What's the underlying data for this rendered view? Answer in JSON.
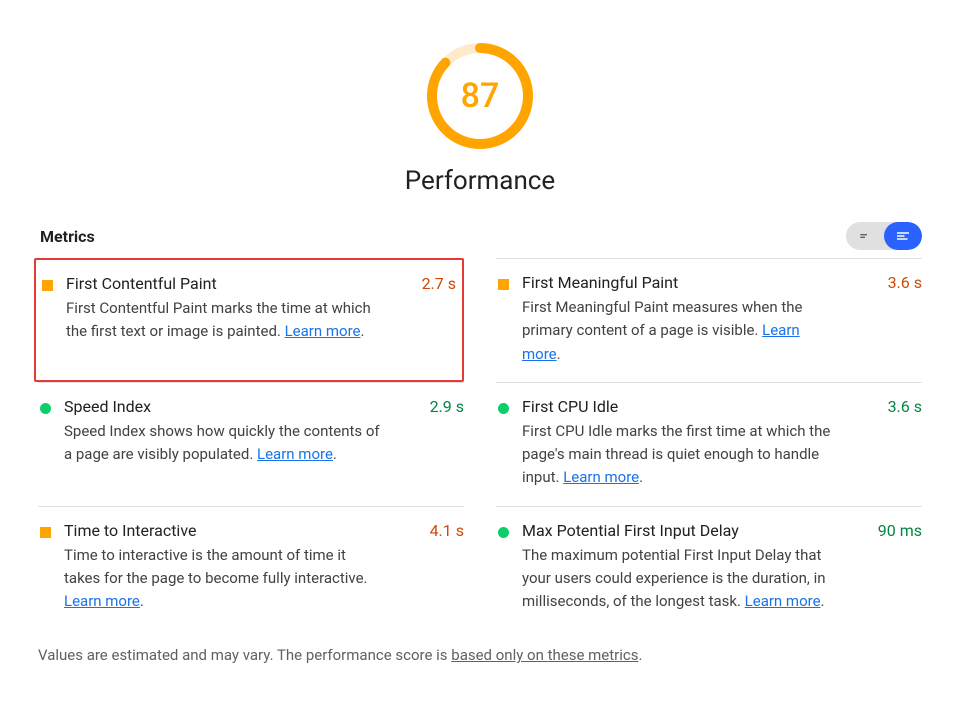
{
  "gauge": {
    "score": "87",
    "label": "Performance"
  },
  "section_title": "Metrics",
  "learn_more_text": "Learn more",
  "metrics": [
    {
      "title": "First Contentful Paint",
      "value": "2.7 s",
      "status": "avg",
      "highlight": true,
      "desc": "First Contentful Paint marks the time at which the first text or image is painted. "
    },
    {
      "title": "First Meaningful Paint",
      "value": "3.6 s",
      "status": "avg",
      "highlight": false,
      "desc": "First Meaningful Paint measures when the primary content of a page is visible. "
    },
    {
      "title": "Speed Index",
      "value": "2.9 s",
      "status": "good",
      "highlight": false,
      "desc": "Speed Index shows how quickly the contents of a page are visibly populated. "
    },
    {
      "title": "First CPU Idle",
      "value": "3.6 s",
      "status": "good",
      "highlight": false,
      "desc": "First CPU Idle marks the first time at which the page's main thread is quiet enough to handle input. "
    },
    {
      "title": "Time to Interactive",
      "value": "4.1 s",
      "status": "avg",
      "highlight": false,
      "desc": "Time to interactive is the amount of time it takes for the page to become fully interactive. "
    },
    {
      "title": "Max Potential First Input Delay",
      "value": "90 ms",
      "status": "good",
      "highlight": false,
      "desc": "The maximum potential First Input Delay that your users could experience is the duration, in milliseconds, of the longest task. "
    }
  ],
  "footnote_prefix": "Values are estimated and may vary. The performance score is ",
  "footnote_link": "based only on these metrics",
  "footnote_suffix": "."
}
